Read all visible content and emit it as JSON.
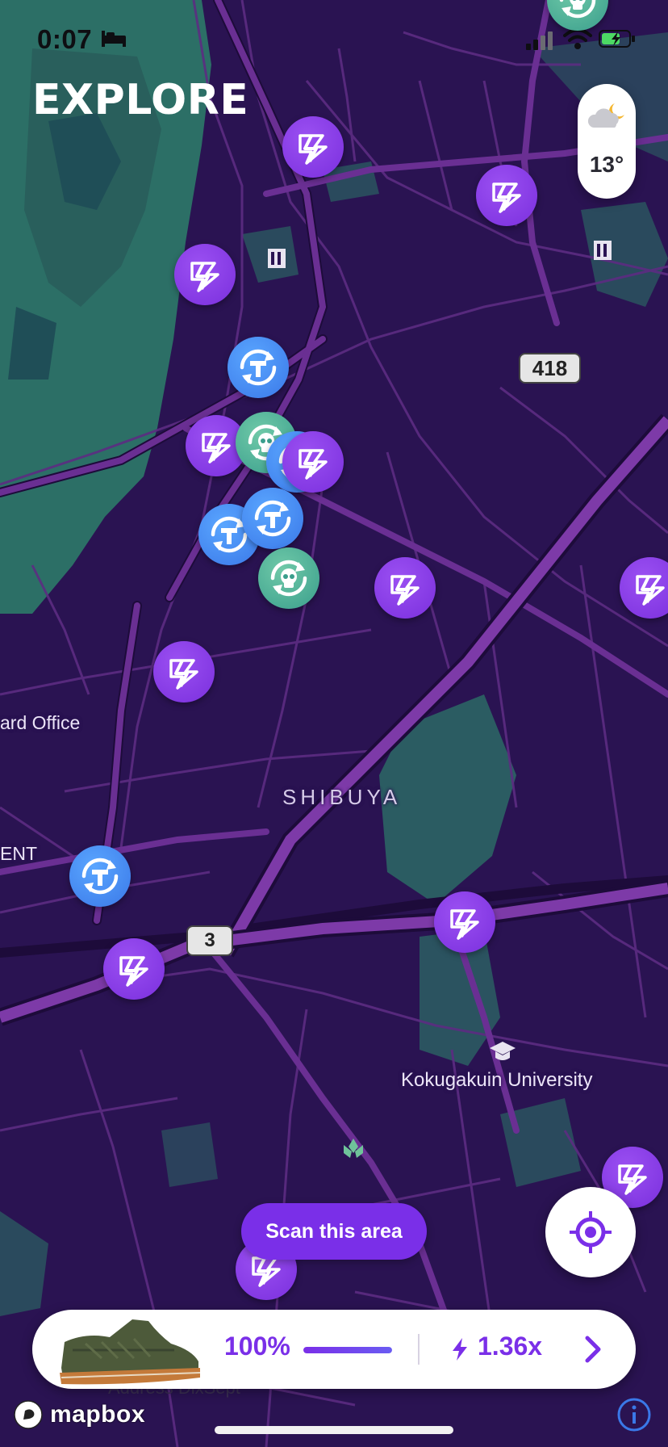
{
  "status_bar": {
    "time": "0:07"
  },
  "header": {
    "title": "EXPLORE"
  },
  "weather": {
    "temperature": "13°",
    "icon": "partly-cloudy-night-icon"
  },
  "map": {
    "labels": {
      "district": "SHIBUYA",
      "university": "Kokugakuin University",
      "ward_office": "ard Office",
      "ent": "ENT",
      "address": "Address DixSept"
    },
    "road_shields": {
      "route_418": "418",
      "route_3": "3"
    },
    "marker_types": [
      "energy-spot-marker",
      "swap-spot-marker",
      "skull-spot-marker"
    ]
  },
  "scan_button": {
    "label": "Scan this area"
  },
  "bottom_bar": {
    "battery_percent": "100%",
    "battery_level": 1.0,
    "multiplier": "1.36x"
  },
  "attribution": {
    "brand": "mapbox"
  },
  "colors": {
    "map_background": "#2a1352",
    "accent_purple": "#7a2fe8",
    "park_green": "#2c6f66",
    "road": "#5a2a7e"
  }
}
